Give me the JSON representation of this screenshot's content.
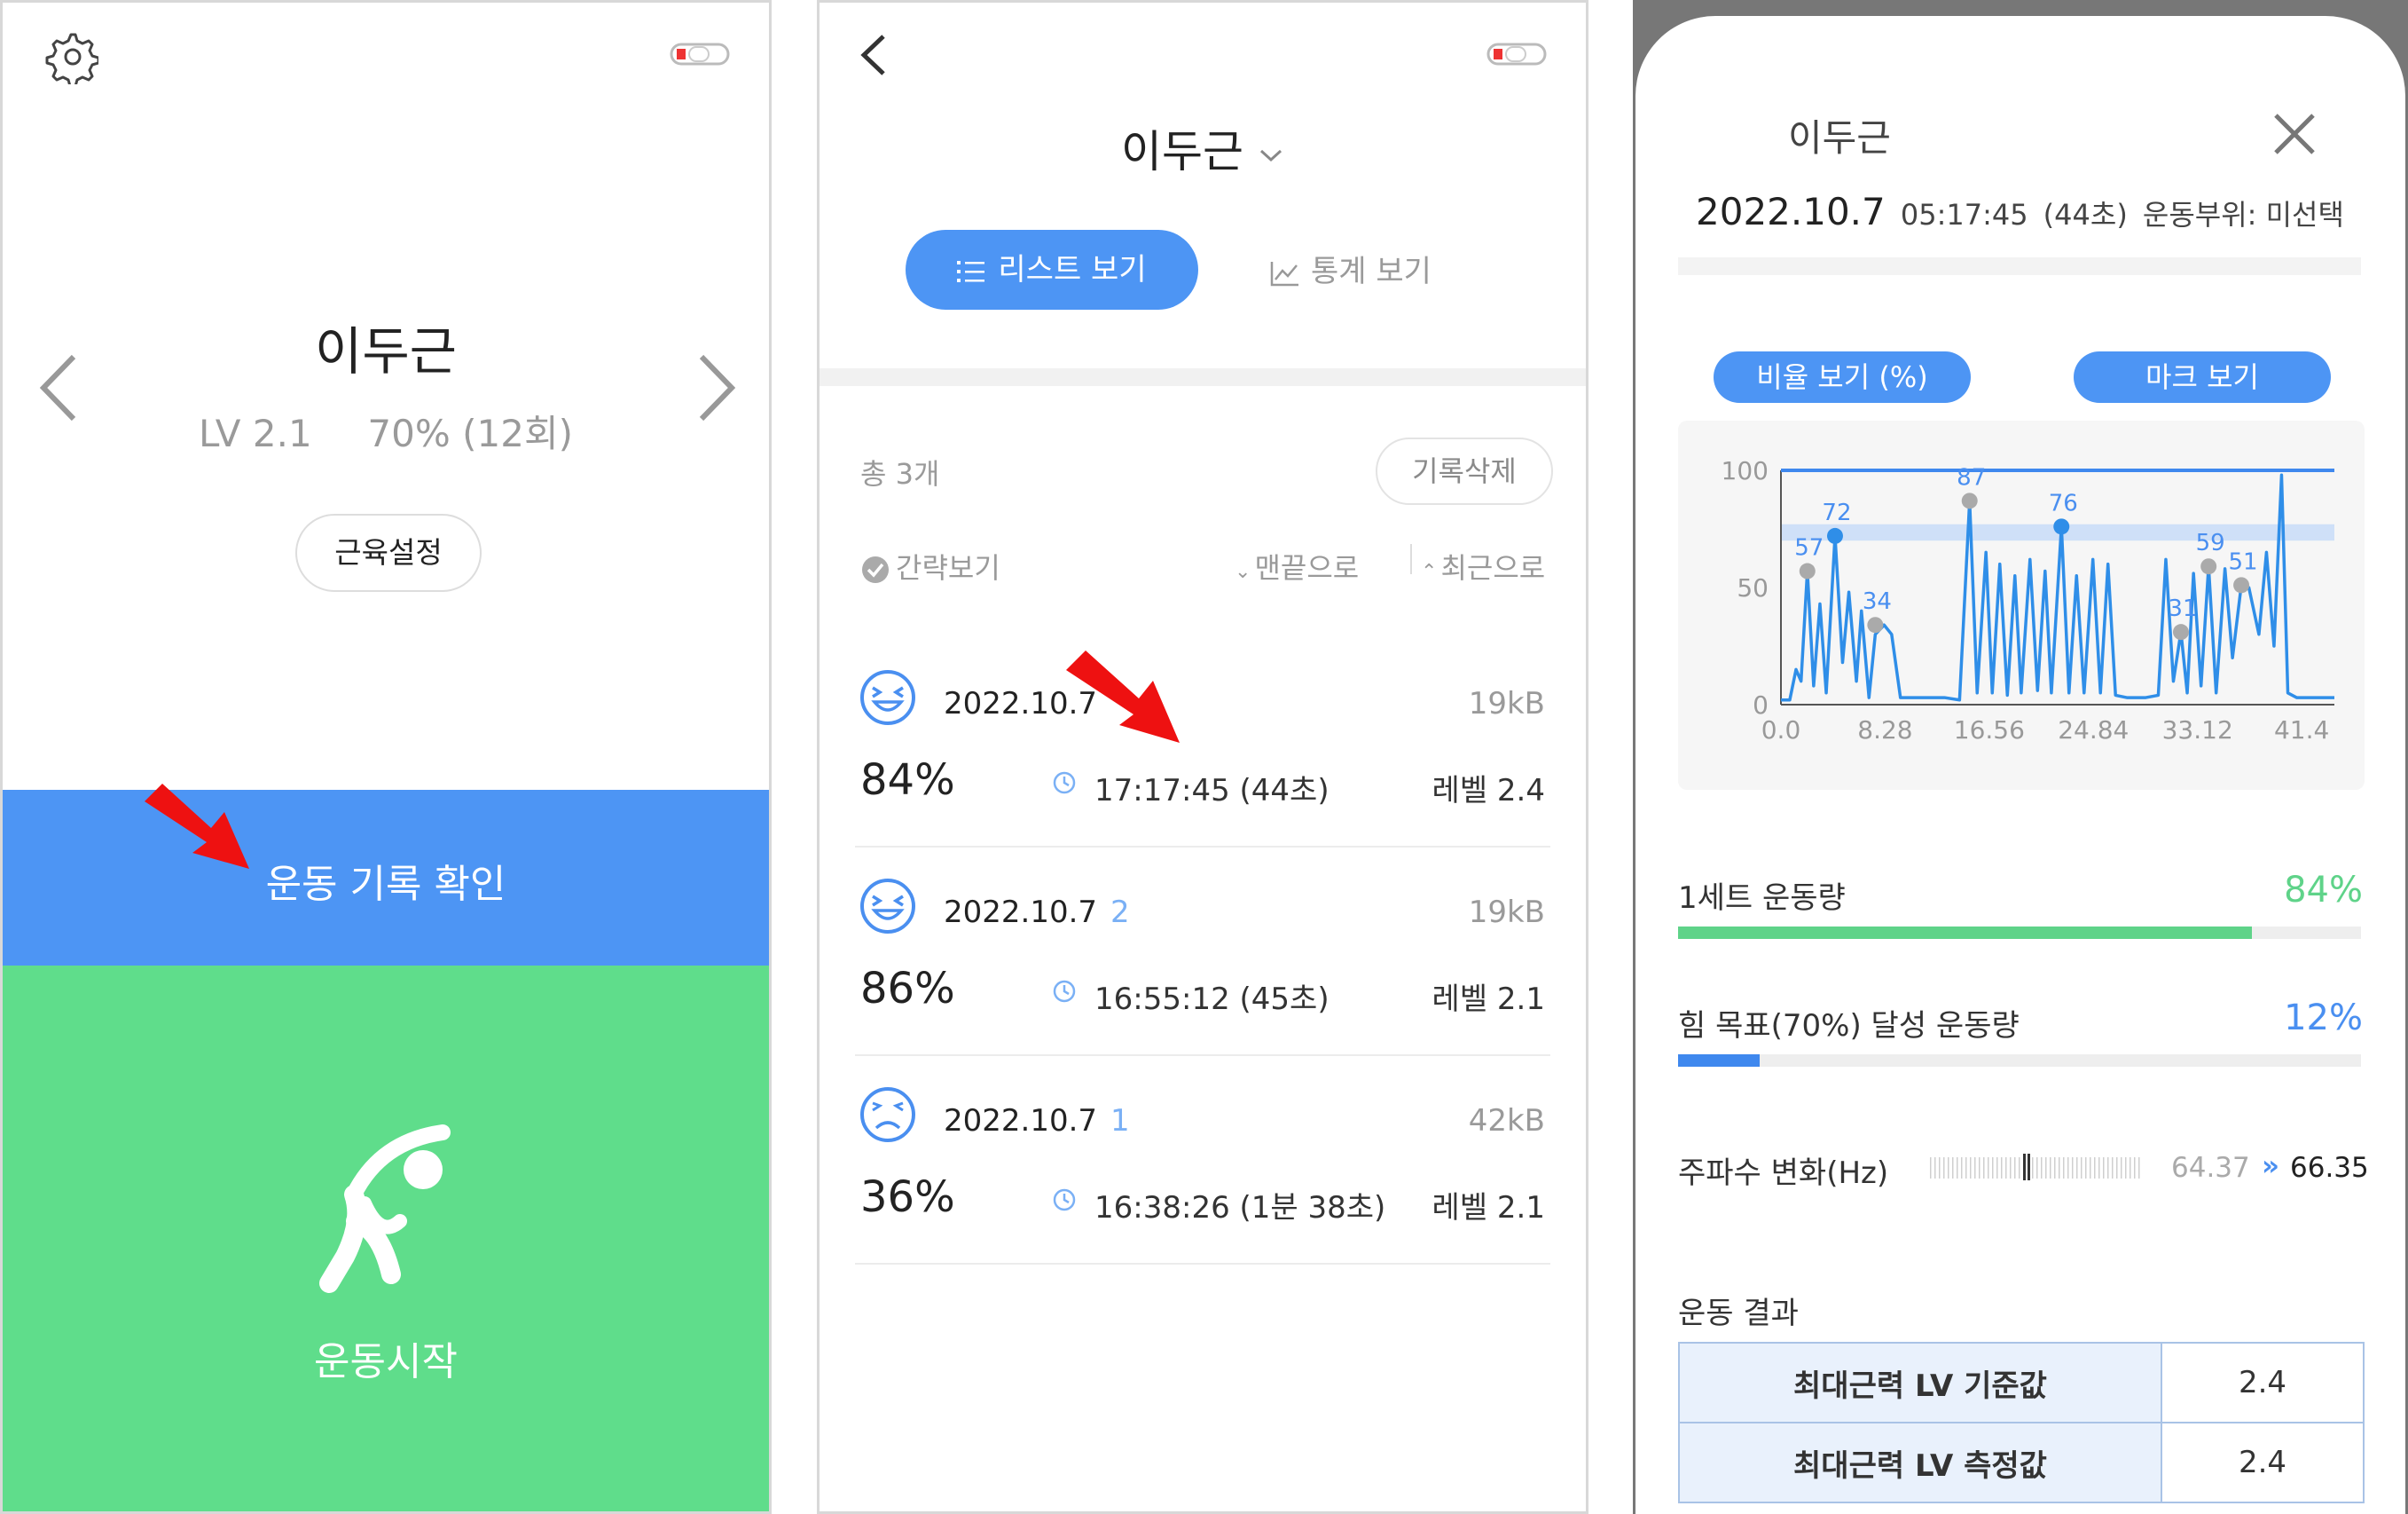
{
  "colors": {
    "accent_blue": "#4d95f4",
    "green": "#5fdd8b",
    "red_arrow": "#ee1111",
    "progress_green": "#5fd389",
    "progress_blue": "#3f88ee"
  },
  "panel1": {
    "name": "이두근",
    "level": "LV 2.1",
    "progress": "70% (12회)",
    "muscle_button": "근육설정",
    "records_button": "운동 기록 확인",
    "start_button": "운동시작",
    "icons": [
      "gear-icon",
      "battery-icon",
      "chevron-left-icon",
      "chevron-right-icon",
      "stretching-person-icon",
      "red-arrow-icon"
    ]
  },
  "panel2": {
    "title": "이두근",
    "tab_list": "리스트 보기",
    "tab_stats": "통계 보기",
    "total": "총 3개",
    "delete_button": "기록삭제",
    "summary_toggle": "간략보기",
    "sort_oldest": "맨끝으로",
    "sort_newest": "최근으로",
    "records": [
      {
        "date": "2022.10.7",
        "count": "",
        "size": "19kB",
        "percent": "84%",
        "time": "17:17:45 (44초)",
        "level": "레벨 2.4",
        "face": "laugh"
      },
      {
        "date": "2022.10.7",
        "count": "2",
        "size": "19kB",
        "percent": "86%",
        "time": "16:55:12 (45초)",
        "level": "레벨 2.1",
        "face": "laugh"
      },
      {
        "date": "2022.10.7",
        "count": "1",
        "size": "42kB",
        "percent": "36%",
        "time": "16:38:26 (1분 38초)",
        "level": "레벨 2.1",
        "face": "sad"
      }
    ]
  },
  "panel3": {
    "title": "이두근",
    "date": "2022.10.7",
    "time": "05:17:45",
    "duration": "(44초)",
    "part": "운동부위: 미선택",
    "btn_ratio": "비율 보기 (%)",
    "btn_mark": "마크 보기",
    "set_label": "1세트 운동량",
    "set_value": "84%",
    "set_fraction": 0.84,
    "goal_label": "힘 목표(70%) 달성 운동량",
    "goal_value": "12%",
    "goal_fraction": 0.12,
    "freq_label": "주파수 변화(Hz)",
    "freq_from": "64.37",
    "freq_arrow": "»",
    "freq_to": "66.35",
    "result_title": "운동 결과",
    "result_rows": [
      {
        "label": "최대근력 LV 기준값",
        "value": "2.4"
      },
      {
        "label": "최대근력 LV 측정값",
        "value": "2.4"
      }
    ]
  },
  "chart_data": {
    "type": "line",
    "xlim": [
      0,
      44
    ],
    "ylim": [
      0,
      100
    ],
    "x_ticks": [
      "0.0",
      "8.28",
      "16.56",
      "24.84",
      "33.12",
      "41.4"
    ],
    "x_tick_values": [
      0,
      8.28,
      16.56,
      24.84,
      33.12,
      41.4
    ],
    "y_ticks": [
      "100",
      "50",
      "0"
    ],
    "y_tick_values": [
      100,
      50,
      0
    ],
    "target_band": [
      70,
      77
    ],
    "top_line": 100,
    "grid": false,
    "series": [
      {
        "points": [
          [
            0,
            2
          ],
          [
            0.7,
            2
          ],
          [
            1.2,
            15
          ],
          [
            1.6,
            10
          ],
          [
            2.1,
            57
          ],
          [
            2.6,
            8
          ],
          [
            3.1,
            43
          ],
          [
            3.6,
            5
          ],
          [
            4.3,
            72
          ],
          [
            4.9,
            18
          ],
          [
            5.4,
            48
          ],
          [
            6.0,
            10
          ],
          [
            6.4,
            40
          ],
          [
            7.0,
            3
          ],
          [
            7.5,
            30
          ],
          [
            8.2,
            34
          ],
          [
            8.8,
            30
          ],
          [
            9.5,
            3
          ],
          [
            12.5,
            3
          ],
          [
            13.0,
            3
          ],
          [
            14.2,
            2
          ],
          [
            15.0,
            87
          ],
          [
            15.6,
            5
          ],
          [
            16.3,
            65
          ],
          [
            16.8,
            5
          ],
          [
            17.4,
            60
          ],
          [
            18.0,
            4
          ],
          [
            18.6,
            55
          ],
          [
            19.1,
            5
          ],
          [
            19.8,
            62
          ],
          [
            20.4,
            6
          ],
          [
            21.0,
            57
          ],
          [
            21.5,
            5
          ],
          [
            22.3,
            76
          ],
          [
            22.9,
            5
          ],
          [
            23.5,
            55
          ],
          [
            24.1,
            5
          ],
          [
            24.8,
            62
          ],
          [
            25.4,
            5
          ],
          [
            26.0,
            60
          ],
          [
            26.6,
            4
          ],
          [
            27.5,
            3
          ],
          [
            29.0,
            3
          ],
          [
            30.0,
            4
          ],
          [
            30.6,
            62
          ],
          [
            31.2,
            10
          ],
          [
            31.8,
            31
          ],
          [
            32.3,
            5
          ],
          [
            32.8,
            56
          ],
          [
            33.4,
            8
          ],
          [
            34.0,
            59
          ],
          [
            34.6,
            5
          ],
          [
            35.3,
            58
          ],
          [
            35.9,
            20
          ],
          [
            36.6,
            51
          ],
          [
            37.2,
            50
          ],
          [
            38.0,
            30
          ],
          [
            38.6,
            65
          ],
          [
            39.2,
            25
          ],
          [
            39.8,
            98
          ],
          [
            40.3,
            5
          ],
          [
            41.0,
            3
          ],
          [
            44,
            3
          ]
        ]
      }
    ],
    "marks": [
      {
        "x": 2.1,
        "y": 57,
        "label": "57",
        "color": "gray"
      },
      {
        "x": 4.3,
        "y": 72,
        "label": "72",
        "color": "blue"
      },
      {
        "x": 7.5,
        "y": 34,
        "label": "34",
        "color": "gray"
      },
      {
        "x": 15.0,
        "y": 87,
        "label": "87",
        "color": "gray"
      },
      {
        "x": 22.3,
        "y": 76,
        "label": "76",
        "color": "blue"
      },
      {
        "x": 31.8,
        "y": 31,
        "label": "31",
        "color": "gray"
      },
      {
        "x": 34.0,
        "y": 59,
        "label": "59",
        "color": "gray"
      },
      {
        "x": 36.6,
        "y": 51,
        "label": "51",
        "color": "gray"
      }
    ]
  }
}
